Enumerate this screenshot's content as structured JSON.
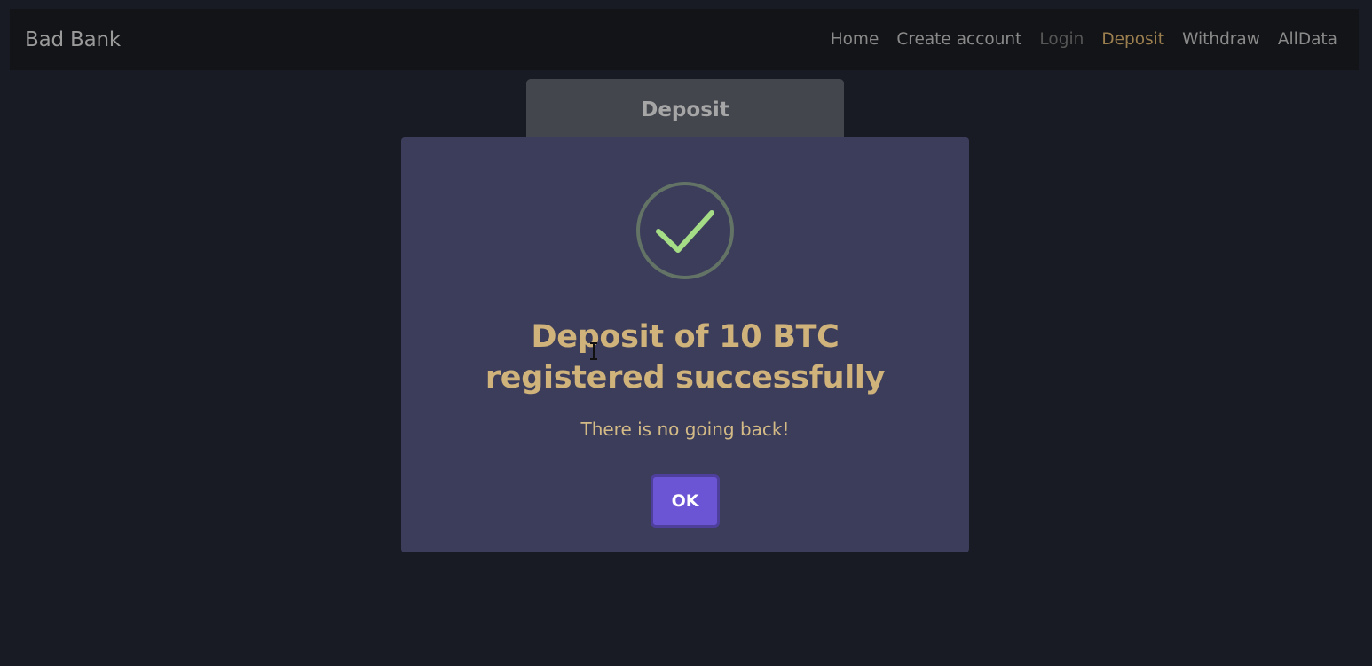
{
  "navbar": {
    "brand": "Bad Bank",
    "links": [
      {
        "label": "Home",
        "state": "normal"
      },
      {
        "label": "Create account",
        "state": "normal"
      },
      {
        "label": "Login",
        "state": "disabled"
      },
      {
        "label": "Deposit",
        "state": "active"
      },
      {
        "label": "Withdraw",
        "state": "normal"
      },
      {
        "label": "AllData",
        "state": "normal"
      }
    ]
  },
  "background_card": {
    "title": "Deposit"
  },
  "modal": {
    "icon": "success-check-icon",
    "title": "Deposit of 10 BTC registered successfully",
    "text": "There is no going back!",
    "ok_label": "OK"
  },
  "colors": {
    "page_background": "#181b23",
    "navbar_background": "#131417",
    "modal_background": "#3c3d5b",
    "title_gold": "#cfb37a",
    "active_link": "#9c7f4f",
    "button_purple": "#6c55d4",
    "check_green": "#a5dc86"
  }
}
